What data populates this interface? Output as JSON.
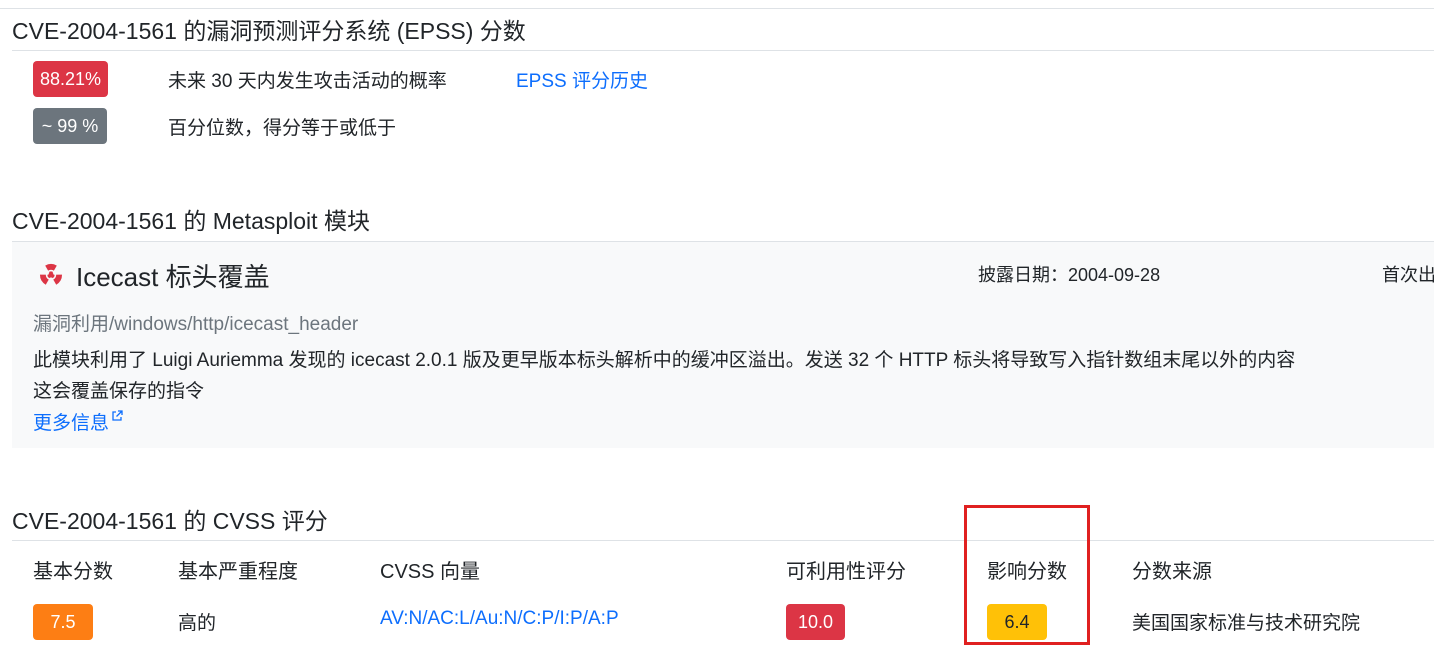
{
  "epss": {
    "title": "CVE-2004-1561 的漏洞预测评分系统 (EPSS) 分数",
    "probability_badge": "88.21%",
    "probability_label": "未来 30 天内发生攻击活动的概率",
    "history_link": "EPSS 评分历史",
    "percentile_badge": "~ 99 %",
    "percentile_label": "百分位数，得分等于或低于"
  },
  "metasploit": {
    "title": "CVE-2004-1561 的 Metasploit 模块",
    "module": {
      "icon": "radiation-icon",
      "name": "Icecast 标头覆盖",
      "disclosure_label": "披露日期：2004-09-28",
      "first_seen_label": "首次出",
      "path": "漏洞利用/windows/http/icecast_header",
      "description_line1": "此模块利用了 Luigi Auriemma 发现的 icecast 2.0.1 版及更早版本标头解析中的缓冲区溢出。发送 32 个 HTTP 标头将导致写入指针数组末尾以外的内容",
      "description_line2": "这会覆盖保存的指令",
      "more_info_link": "更多信息"
    }
  },
  "cvss": {
    "title": "CVE-2004-1561 的 CVSS 评分",
    "headers": {
      "base_score": "基本分数",
      "base_severity": "基本严重程度",
      "vector": "CVSS 向量",
      "exploitability": "可利用性评分",
      "impact": "影响分数",
      "source": "分数来源"
    },
    "row": {
      "base_score": "7.5",
      "base_severity": "高的",
      "vector": "AV:N/AC:L/Au:N/C:P/I:P/A:P",
      "exploitability": "10.0",
      "impact": "6.4",
      "source": "美国国家标准与技术研究院"
    }
  },
  "colors": {
    "danger": "#dc3545",
    "secondary": "#6c757d",
    "orange": "#fd7e14",
    "warning": "#ffc107",
    "link": "#0d6efd",
    "highlight": "#e02020"
  }
}
